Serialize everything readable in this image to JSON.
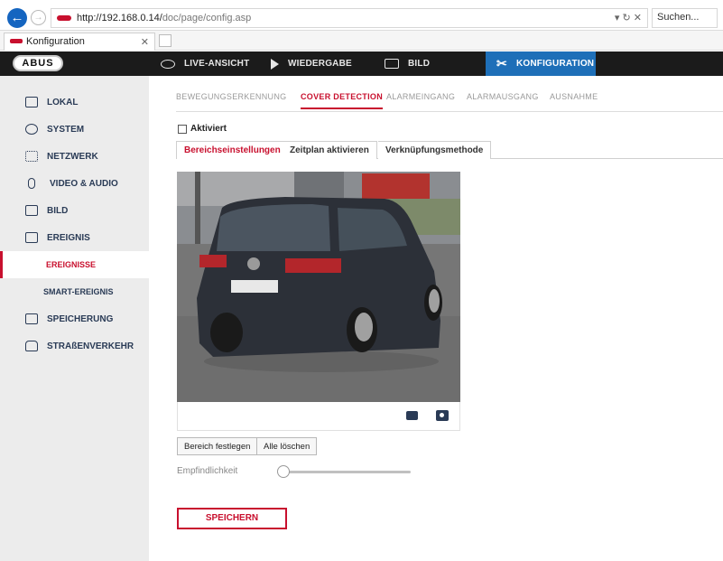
{
  "browser": {
    "url_host": "http://192.168.0.14/",
    "url_path": "doc/page/config.asp",
    "url_actions": "▾ ↻ ✕",
    "search_placeholder": "Suchen...",
    "tab_title": "Konfiguration",
    "tab_close": "✕"
  },
  "topnav": {
    "logo": "ABUS",
    "items": [
      {
        "label": "LIVE-ANSICHT",
        "icon": "eye-icon"
      },
      {
        "label": "WIEDERGABE",
        "icon": "play-icon"
      },
      {
        "label": "BILD",
        "icon": "image-icon"
      },
      {
        "label": "KONFIGURATION",
        "icon": "wrench-icon",
        "active": true
      }
    ],
    "active_color": "#1e6fb8"
  },
  "sidebar": {
    "items": [
      {
        "label": "LOKAL",
        "icon": "monitor-icon"
      },
      {
        "label": "SYSTEM",
        "icon": "gear-icon"
      },
      {
        "label": "NETZWERK",
        "icon": "network-icon"
      },
      {
        "label": "VIDEO & AUDIO",
        "icon": "microphone-icon"
      },
      {
        "label": "BILD",
        "icon": "image-icon"
      },
      {
        "label": "EREIGNIS",
        "icon": "calendar-icon"
      }
    ],
    "subitems": [
      {
        "label": "EREIGNISSE",
        "active": true
      },
      {
        "label": "SMART-EREIGNIS"
      }
    ],
    "items_after": [
      {
        "label": "SPEICHERUNG",
        "icon": "storage-icon"
      },
      {
        "label": "STRAßENVERKEHR",
        "icon": "car-icon"
      }
    ]
  },
  "subtabs": [
    {
      "label": "BEWEGUNGSERKENNUNG"
    },
    {
      "label": "COVER DETECTION",
      "active": true
    },
    {
      "label": "ALARMEINGANG"
    },
    {
      "label": "ALARMAUSGANG"
    },
    {
      "label": "AUSNAHME"
    }
  ],
  "aktiviert_label": "Aktiviert",
  "steps": [
    {
      "label": "Bereichseinstellungen",
      "active": true
    },
    {
      "label": "Zeitplan aktivieren"
    },
    {
      "label": "Verknüpfungsmethode"
    }
  ],
  "buttons": {
    "set_area": "Bereich festlegen",
    "clear_all": "Alle löschen",
    "save": "SPEICHERN"
  },
  "sensitivity_label": "Empfindlichkeit",
  "sensitivity_value": 0,
  "accent_color": "#c8102e"
}
